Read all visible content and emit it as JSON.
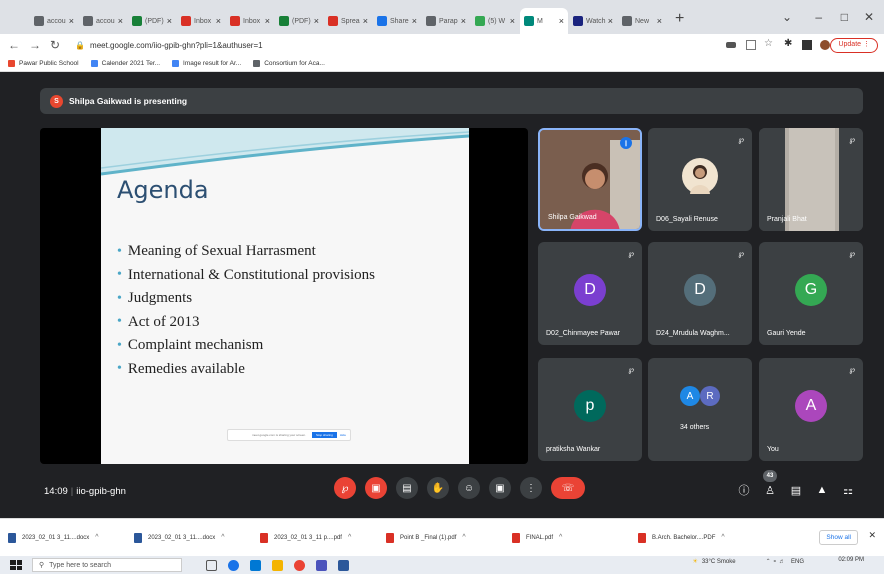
{
  "browser": {
    "tabs": [
      {
        "label": "accou",
        "color": "#5f6368",
        "active": false
      },
      {
        "label": "accou",
        "color": "#5f6368",
        "active": false
      },
      {
        "label": "(PDF)",
        "color": "#188038",
        "active": false
      },
      {
        "label": "Inbox",
        "color": "#d93025",
        "active": false
      },
      {
        "label": "Inbox",
        "color": "#d93025",
        "active": false
      },
      {
        "label": "(PDF)",
        "color": "#188038",
        "active": false
      },
      {
        "label": "Sprea",
        "color": "#d93025",
        "active": false
      },
      {
        "label": "Share",
        "color": "#1a73e8",
        "active": false
      },
      {
        "label": "Parap",
        "color": "#5f6368",
        "active": false
      },
      {
        "label": "(5) W",
        "color": "#34a853",
        "active": false
      },
      {
        "label": "M",
        "color": "#00897b",
        "active": true
      },
      {
        "label": "Watch",
        "color": "#1a237e",
        "active": false
      },
      {
        "label": "New",
        "color": "#5f6368",
        "active": false
      }
    ],
    "new_tab": "+",
    "url": "meet.google.com/iio-gpib-ghn?pli=1&authuser=1",
    "update_label": "Update",
    "bookmarks": [
      {
        "label": "Pawar Public School",
        "color": "#e8472f"
      },
      {
        "label": "Calender 2021 Ter...",
        "color": "#4285f4"
      },
      {
        "label": "Image result for Ar...",
        "color": "#4285f4"
      },
      {
        "label": "Consortium for Aca...",
        "color": "#5f6368"
      }
    ]
  },
  "meet": {
    "presenter_initial": "S",
    "banner": "Shilpa Gaikwad is presenting",
    "slide": {
      "title": "Agenda",
      "items": [
        "Meaning of Sexual Harrasment",
        "International  & Constitutional provisions",
        "Judgments",
        "Act of 2013",
        "Complaint mechanism",
        "Remedies available"
      ],
      "share_text": "meet.google.com is sharing your screen.",
      "stop_label": "Stop sharing",
      "hide_label": "Hide"
    },
    "participants": [
      {
        "name": "Shilpa Gaikwad",
        "type": "video"
      },
      {
        "name": "D06_Sayali Renuse",
        "type": "photo"
      },
      {
        "name": "Pranjali Bhat",
        "type": "video"
      },
      {
        "name": "D02_Chinmayee Pawar",
        "initial": "D",
        "color": "#7b3fd0"
      },
      {
        "name": "D24_Mrudula Waghm...",
        "initial": "D",
        "color": "#546e7a"
      },
      {
        "name": "Gauri Yende",
        "initial": "G",
        "color": "#34a853"
      },
      {
        "name": "pratiksha Wankar",
        "initial": "p",
        "color": "#00695c"
      },
      {
        "name": "34 others",
        "initials": [
          "A",
          "R"
        ],
        "colors": [
          "#1e88e5",
          "#5c6bc0"
        ]
      },
      {
        "name": "You",
        "initial": "A",
        "color": "#ab47bc"
      }
    ],
    "time": "14:09",
    "meeting_code": "iio-gpib-ghn",
    "people_count": "43"
  },
  "downloads": {
    "items": [
      {
        "label": "2023_02_01 3_11....docx",
        "type": "docx"
      },
      {
        "label": "2023_02_01 3_11....docx",
        "type": "docx"
      },
      {
        "label": "2023_02_01 3_11 p....pdf",
        "type": "pdf"
      },
      {
        "label": "Point B _Final (1).pdf",
        "type": "pdf"
      },
      {
        "label": "FINAL.pdf",
        "type": "pdf"
      },
      {
        "label": "B.Arch. Bachelor....PDF",
        "type": "pdf"
      }
    ],
    "show_all": "Show all"
  },
  "taskbar": {
    "search_placeholder": "Type here to search",
    "weather": "33°C Smoke",
    "lang": "ENG",
    "time": "02:09 PM"
  },
  "colors": {
    "meet_bg": "#202124",
    "tile_bg": "#3c4043",
    "accent_red": "#ea4335"
  }
}
